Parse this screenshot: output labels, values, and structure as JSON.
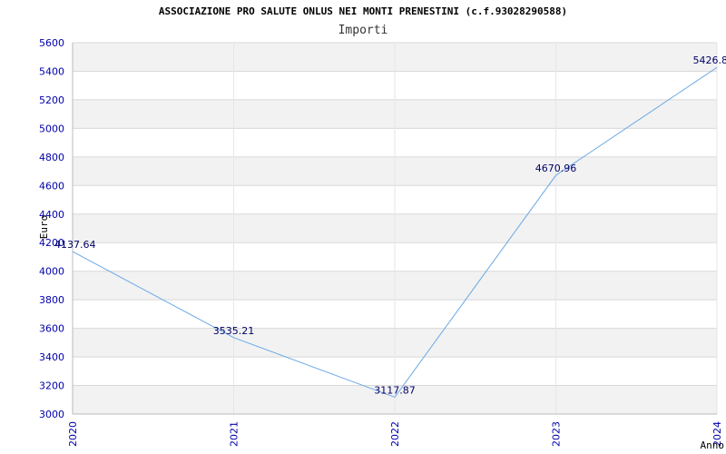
{
  "chart_data": {
    "type": "line",
    "title": "ASSOCIAZIONE PRO SALUTE ONLUS NEI MONTI PRENESTINI (c.f.93028290588)",
    "subtitle": "Importi",
    "xlabel": "Anno",
    "ylabel": "Euro",
    "x": [
      "2020",
      "2021",
      "2022",
      "2023",
      "2024"
    ],
    "series": [
      {
        "values": [
          4137.64,
          3535.21,
          3117.87,
          4670.96,
          5426.8
        ],
        "labels": [
          "4137.64",
          "3535.21",
          "3117.87",
          "4670.96",
          "5426.8"
        ]
      }
    ],
    "ylim": [
      3000,
      5600
    ],
    "yticks": [
      3000,
      3200,
      3400,
      3600,
      3800,
      4000,
      4200,
      4400,
      4600,
      4800,
      5000,
      5200,
      5400,
      5600
    ],
    "grid": true,
    "colors": {
      "line": "#6aa8e6",
      "band": "#f2f2f2",
      "grid": "#d8d8d8",
      "tick": "#0000aa"
    }
  }
}
